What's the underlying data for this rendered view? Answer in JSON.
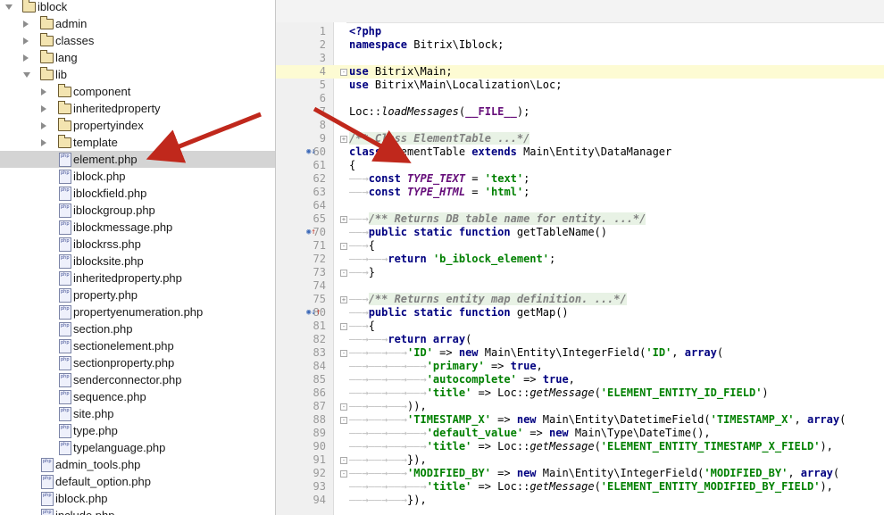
{
  "project_tree": {
    "items": [
      {
        "label": "iblock",
        "kind": "folder",
        "depth": 0,
        "open": true
      },
      {
        "label": "admin",
        "kind": "folder",
        "depth": 1,
        "open": false
      },
      {
        "label": "classes",
        "kind": "folder",
        "depth": 1,
        "open": false
      },
      {
        "label": "lang",
        "kind": "folder",
        "depth": 1,
        "open": false
      },
      {
        "label": "lib",
        "kind": "folder",
        "depth": 1,
        "open": true
      },
      {
        "label": "component",
        "kind": "folder",
        "depth": 2,
        "open": false
      },
      {
        "label": "inheritedproperty",
        "kind": "folder",
        "depth": 2,
        "open": false
      },
      {
        "label": "propertyindex",
        "kind": "folder",
        "depth": 2,
        "open": false
      },
      {
        "label": "template",
        "kind": "folder",
        "depth": 2,
        "open": false
      },
      {
        "label": "element.php",
        "kind": "file",
        "depth": 2,
        "selected": true
      },
      {
        "label": "iblock.php",
        "kind": "file",
        "depth": 2
      },
      {
        "label": "iblockfield.php",
        "kind": "file",
        "depth": 2
      },
      {
        "label": "iblockgroup.php",
        "kind": "file",
        "depth": 2
      },
      {
        "label": "iblockmessage.php",
        "kind": "file",
        "depth": 2
      },
      {
        "label": "iblockrss.php",
        "kind": "file",
        "depth": 2
      },
      {
        "label": "iblocksite.php",
        "kind": "file",
        "depth": 2
      },
      {
        "label": "inheritedproperty.php",
        "kind": "file",
        "depth": 2
      },
      {
        "label": "property.php",
        "kind": "file",
        "depth": 2
      },
      {
        "label": "propertyenumeration.php",
        "kind": "file",
        "depth": 2
      },
      {
        "label": "section.php",
        "kind": "file",
        "depth": 2
      },
      {
        "label": "sectionelement.php",
        "kind": "file",
        "depth": 2
      },
      {
        "label": "sectionproperty.php",
        "kind": "file",
        "depth": 2
      },
      {
        "label": "senderconnector.php",
        "kind": "file",
        "depth": 2
      },
      {
        "label": "sequence.php",
        "kind": "file",
        "depth": 2
      },
      {
        "label": "site.php",
        "kind": "file",
        "depth": 2
      },
      {
        "label": "type.php",
        "kind": "file",
        "depth": 2
      },
      {
        "label": "typelanguage.php",
        "kind": "file",
        "depth": 2
      },
      {
        "label": "admin_tools.php",
        "kind": "file",
        "depth": 1
      },
      {
        "label": "default_option.php",
        "kind": "file",
        "depth": 1
      },
      {
        "label": "iblock.php",
        "kind": "file",
        "depth": 1
      },
      {
        "label": "include.php",
        "kind": "file",
        "depth": 1
      }
    ],
    "file_icon_text": "php"
  },
  "editor": {
    "highlighted_line": "4",
    "lines": [
      {
        "n": "1",
        "tokens": [
          [
            "kw",
            "<?php"
          ]
        ]
      },
      {
        "n": "2",
        "tokens": [
          [
            "kw",
            "namespace"
          ],
          [
            "",
            "Bitrix\\Iblock;"
          ]
        ]
      },
      {
        "n": "3",
        "tokens": []
      },
      {
        "n": "4",
        "tokens": [
          [
            "kw",
            "use"
          ],
          [
            "",
            "Bitrix\\Main;"
          ]
        ],
        "fold": "-"
      },
      {
        "n": "5",
        "tokens": [
          [
            "kw",
            "use"
          ],
          [
            "",
            "Bitrix\\Main\\Localization\\Loc;"
          ]
        ]
      },
      {
        "n": "6",
        "tokens": []
      },
      {
        "n": "7",
        "tokens": [
          [
            "",
            "Loc::"
          ],
          [
            "fn",
            "loadMessages"
          ],
          [
            "",
            "("
          ],
          [
            "mg",
            "__FILE__"
          ],
          [
            "",
            ");"
          ]
        ]
      },
      {
        "n": "8",
        "tokens": []
      },
      {
        "n": "9",
        "tokens": [
          [
            "cmtbox",
            "/** Class ElementTable ...*/"
          ]
        ],
        "fold": "+"
      },
      {
        "n": "60",
        "tokens": [
          [
            "kw",
            "class"
          ],
          [
            "",
            "ElementTable "
          ],
          [
            "kw",
            "extends"
          ],
          [
            "",
            "Main\\Entity\\DataManager"
          ]
        ],
        "marks": "o↓"
      },
      {
        "n": "61",
        "tokens": [
          [
            "",
            "{"
          ]
        ]
      },
      {
        "n": "62",
        "tokens": [
          [
            "ind",
            "——→"
          ],
          [
            "kw",
            "const"
          ],
          [
            "cst",
            "TYPE_TEXT"
          ],
          [
            "",
            " = "
          ],
          [
            "str",
            "'text'"
          ],
          [
            "",
            ";"
          ]
        ]
      },
      {
        "n": "63",
        "tokens": [
          [
            "ind",
            "——→"
          ],
          [
            "kw",
            "const"
          ],
          [
            "cst",
            "TYPE_HTML"
          ],
          [
            "",
            " = "
          ],
          [
            "str",
            "'html'"
          ],
          [
            "",
            ";"
          ]
        ]
      },
      {
        "n": "64",
        "tokens": []
      },
      {
        "n": "65",
        "tokens": [
          [
            "ind",
            "——→"
          ],
          [
            "cmtbox",
            "/** Returns DB table name for entity. ...*/"
          ]
        ],
        "fold": "+"
      },
      {
        "n": "70",
        "tokens": [
          [
            "ind",
            "——→"
          ],
          [
            "kw",
            "public static function"
          ],
          [
            "",
            "getTableName()"
          ]
        ],
        "marks": "o↑"
      },
      {
        "n": "71",
        "tokens": [
          [
            "ind",
            "——→"
          ],
          [
            "",
            "{"
          ]
        ],
        "fold": "-"
      },
      {
        "n": "72",
        "tokens": [
          [
            "ind",
            "——→——→"
          ],
          [
            "kw",
            "return"
          ],
          [
            "str",
            "'b_iblock_element'"
          ],
          [
            "",
            ";"
          ]
        ]
      },
      {
        "n": "73",
        "tokens": [
          [
            "ind",
            "——→"
          ],
          [
            "",
            "}"
          ]
        ],
        "fold": "-"
      },
      {
        "n": "74",
        "tokens": []
      },
      {
        "n": "75",
        "tokens": [
          [
            "ind",
            "——→"
          ],
          [
            "cmtbox",
            "/** Returns entity map definition. ...*/"
          ]
        ],
        "fold": "+"
      },
      {
        "n": "80",
        "tokens": [
          [
            "ind",
            "——→"
          ],
          [
            "kw",
            "public static function"
          ],
          [
            "",
            "getMap()"
          ]
        ],
        "marks": "o↓↑"
      },
      {
        "n": "81",
        "tokens": [
          [
            "ind",
            "——→"
          ],
          [
            "",
            "{"
          ]
        ],
        "fold": "-"
      },
      {
        "n": "82",
        "tokens": [
          [
            "ind",
            "——→——→"
          ],
          [
            "kw",
            "return array"
          ],
          [
            "",
            "("
          ]
        ]
      },
      {
        "n": "83",
        "tokens": [
          [
            "ind",
            "——→——→——→"
          ],
          [
            "str",
            "'ID'"
          ],
          [
            "",
            " => "
          ],
          [
            "kw",
            "new"
          ],
          [
            "",
            "Main\\Entity\\IntegerField("
          ],
          [
            "str",
            "'ID'"
          ],
          [
            "",
            ", "
          ],
          [
            "kw",
            "array"
          ],
          [
            "",
            "("
          ]
        ],
        "fold": "-"
      },
      {
        "n": "84",
        "tokens": [
          [
            "ind",
            "——→——→——→——→"
          ],
          [
            "str",
            "'primary'"
          ],
          [
            "",
            " => "
          ],
          [
            "kw",
            "true"
          ],
          [
            "",
            ","
          ]
        ]
      },
      {
        "n": "85",
        "tokens": [
          [
            "ind",
            "——→——→——→——→"
          ],
          [
            "str",
            "'autocomplete'"
          ],
          [
            "",
            " => "
          ],
          [
            "kw",
            "true"
          ],
          [
            "",
            ","
          ]
        ]
      },
      {
        "n": "86",
        "tokens": [
          [
            "ind",
            "——→——→——→——→"
          ],
          [
            "str",
            "'title'"
          ],
          [
            "",
            " => Loc::"
          ],
          [
            "fn",
            "getMessage"
          ],
          [
            "",
            "("
          ],
          [
            "str",
            "'ELEMENT_ENTITY_ID_FIELD'"
          ],
          [
            "",
            ")"
          ]
        ]
      },
      {
        "n": "87",
        "tokens": [
          [
            "ind",
            "——→——→——→"
          ],
          [
            "",
            ")),"
          ]
        ],
        "fold": "-"
      },
      {
        "n": "88",
        "tokens": [
          [
            "ind",
            "——→——→——→"
          ],
          [
            "str",
            "'TIMESTAMP_X'"
          ],
          [
            "",
            " => "
          ],
          [
            "kw",
            "new"
          ],
          [
            "",
            "Main\\Entity\\DatetimeField("
          ],
          [
            "str",
            "'TIMESTAMP_X'"
          ],
          [
            "",
            ", "
          ],
          [
            "kw",
            "array"
          ],
          [
            "",
            "("
          ]
        ],
        "fold": "-"
      },
      {
        "n": "89",
        "tokens": [
          [
            "ind",
            "——→——→——→——→"
          ],
          [
            "str",
            "'default_value'"
          ],
          [
            "",
            " => "
          ],
          [
            "kw",
            "new"
          ],
          [
            "",
            "Main\\Type\\DateTime(),"
          ]
        ]
      },
      {
        "n": "90",
        "tokens": [
          [
            "ind",
            "——→——→——→——→"
          ],
          [
            "str",
            "'title'"
          ],
          [
            "",
            " => Loc::"
          ],
          [
            "fn",
            "getMessage"
          ],
          [
            "",
            "("
          ],
          [
            "str",
            "'ELEMENT_ENTITY_TIMESTAMP_X_FIELD'"
          ],
          [
            "",
            "),"
          ]
        ]
      },
      {
        "n": "91",
        "tokens": [
          [
            "ind",
            "——→——→——→"
          ],
          [
            "",
            "}),"
          ]
        ],
        "fold": "-"
      },
      {
        "n": "92",
        "tokens": [
          [
            "ind",
            "——→——→——→"
          ],
          [
            "str",
            "'MODIFIED_BY'"
          ],
          [
            "",
            " => "
          ],
          [
            "kw",
            "new"
          ],
          [
            "",
            "Main\\Entity\\IntegerField("
          ],
          [
            "str",
            "'MODIFIED_BY'"
          ],
          [
            "",
            ", "
          ],
          [
            "kw",
            "array"
          ],
          [
            "",
            "("
          ]
        ],
        "fold": "-"
      },
      {
        "n": "93",
        "tokens": [
          [
            "ind",
            "——→——→——→——→"
          ],
          [
            "str",
            "'title'"
          ],
          [
            "",
            " => Loc::"
          ],
          [
            "fn",
            "getMessage"
          ],
          [
            "",
            "("
          ],
          [
            "str",
            "'ELEMENT_ENTITY_MODIFIED_BY_FIELD'"
          ],
          [
            "",
            "),"
          ]
        ]
      },
      {
        "n": "94",
        "tokens": [
          [
            "ind",
            "——→——→——→"
          ],
          [
            "",
            "}),"
          ]
        ]
      }
    ]
  },
  "colors": {
    "annotation_arrow": "#c0281c",
    "selection": "#d4d4d4",
    "current_line": "#fdfbd3"
  }
}
